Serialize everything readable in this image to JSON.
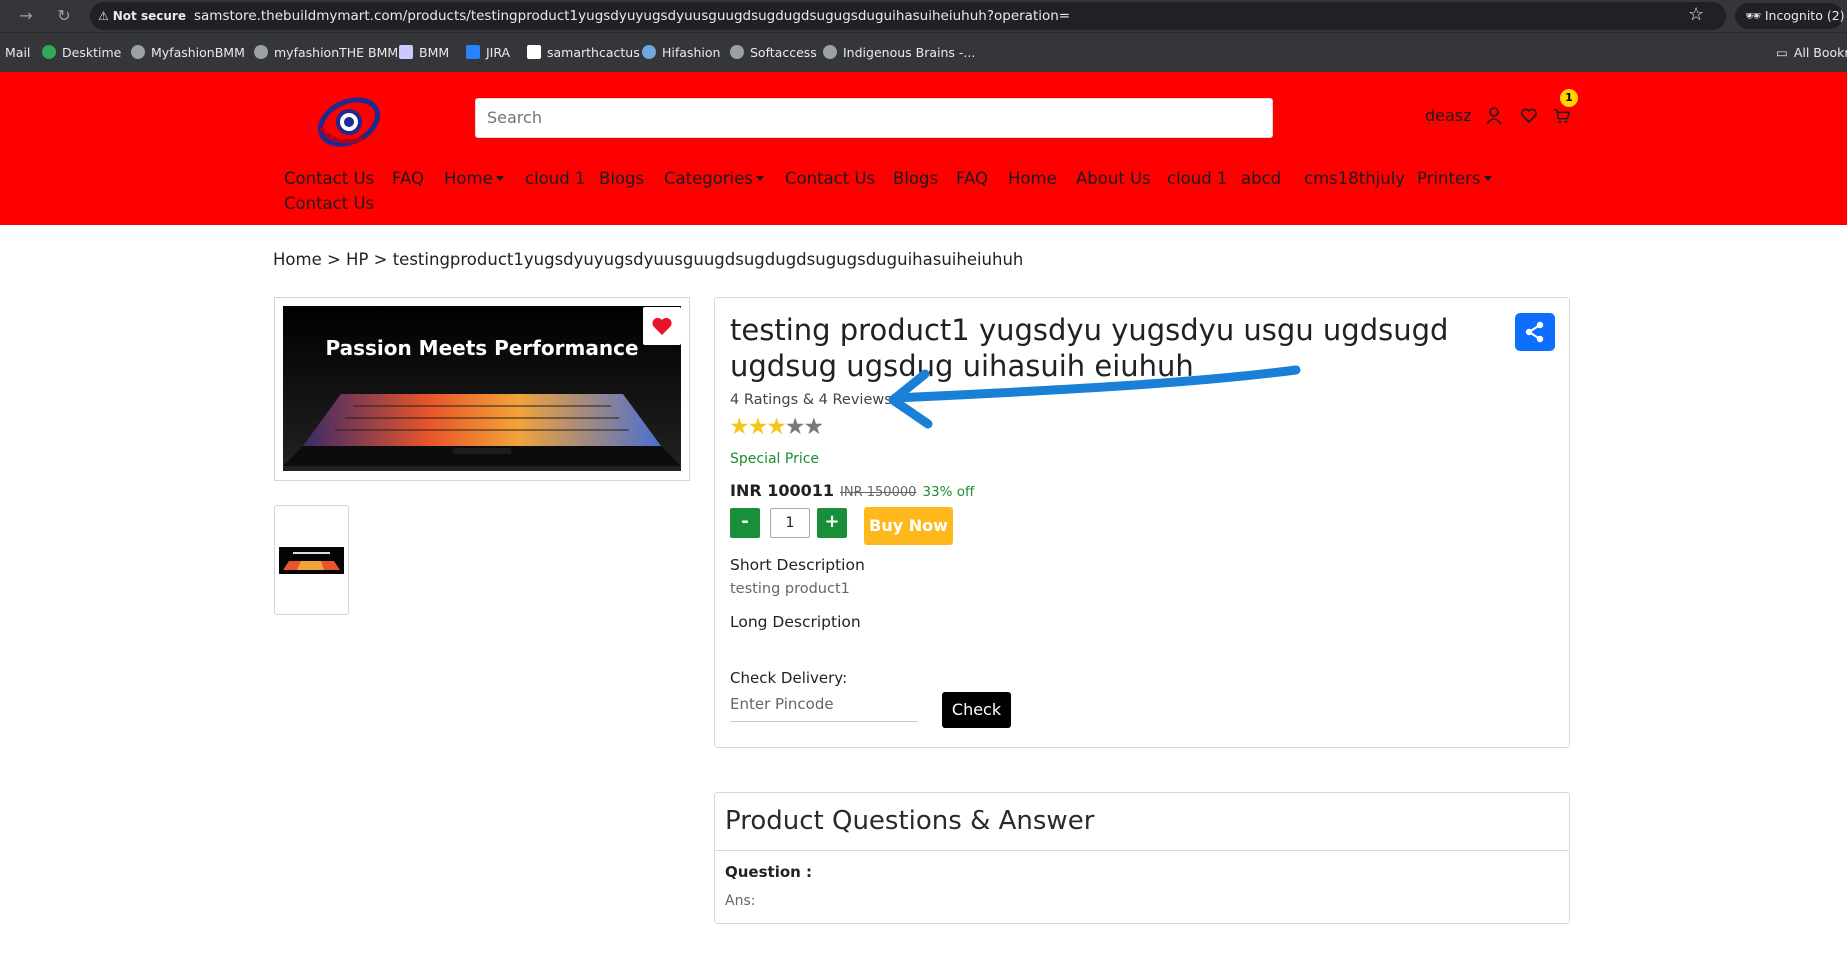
{
  "browser": {
    "not_secure": "Not secure",
    "url": "samstore.thebuildmymart.com/products/testingproduct1yugsdyuyugsdyuusguugdsugdugdsugugsduguihasuiheiuhuh?operation=",
    "incognito": "Incognito (2)",
    "bookmarks": [
      "Mail",
      "Desktime",
      "MyfashionBMM",
      "myfashionTHE BMM",
      "BMM",
      "JIRA",
      "samarthcactus",
      "Hifashion",
      "Softaccess",
      "Indigenous Brains -...",
      "All Bookmarks"
    ]
  },
  "header": {
    "search_placeholder": "Search",
    "user_name": "deasz",
    "cart_count": "1",
    "menu_row1": [
      "Contact Us",
      "FAQ",
      "Home",
      "cloud 1",
      "Blogs",
      "Categories",
      "Contact Us",
      "Blogs",
      "FAQ",
      "Home",
      "About Us",
      "cloud 1",
      "abcd",
      "cms18thjuly",
      "Printers"
    ],
    "menu_row2": [
      "Contact Us"
    ]
  },
  "breadcrumb": "Home > HP > testingproduct1yugsdyuyugsdyuusguugdsugdugdsugugsduguihasuiheiuhuh",
  "product": {
    "image_text": "Passion Meets Performance",
    "title": "testing product1 yugsdyu yugsdyu usgu ugdsugd ugdsug ugsdug uihasuih eiuhuh",
    "ratings_text": "4 Ratings & 4 Reviews",
    "rating": 3,
    "rating_max": 5,
    "special_price_label": "Special Price",
    "price": "INR 100011",
    "mrp": "INR 150000",
    "discount": "33% off",
    "qty_minus": "-",
    "quantity": "1",
    "qty_plus": "+",
    "buy_now": "Buy Now",
    "short_desc_label": "Short Description",
    "short_desc": "testing product1",
    "long_desc_label": "Long Description",
    "check_delivery_label": "Check Delivery:",
    "pincode_placeholder": "Enter Pincode",
    "check_button": "Check"
  },
  "qa": {
    "title": "Product Questions & Answer",
    "question_label": "Question :",
    "answer_label": "Ans:"
  },
  "colors": {
    "header_bg": "#ff0000",
    "buy_now": "#ffb81c",
    "qty_buttons": "#1a8f3a",
    "share_button": "#0d6efd",
    "annotation_arrow": "#1a7fd6"
  }
}
